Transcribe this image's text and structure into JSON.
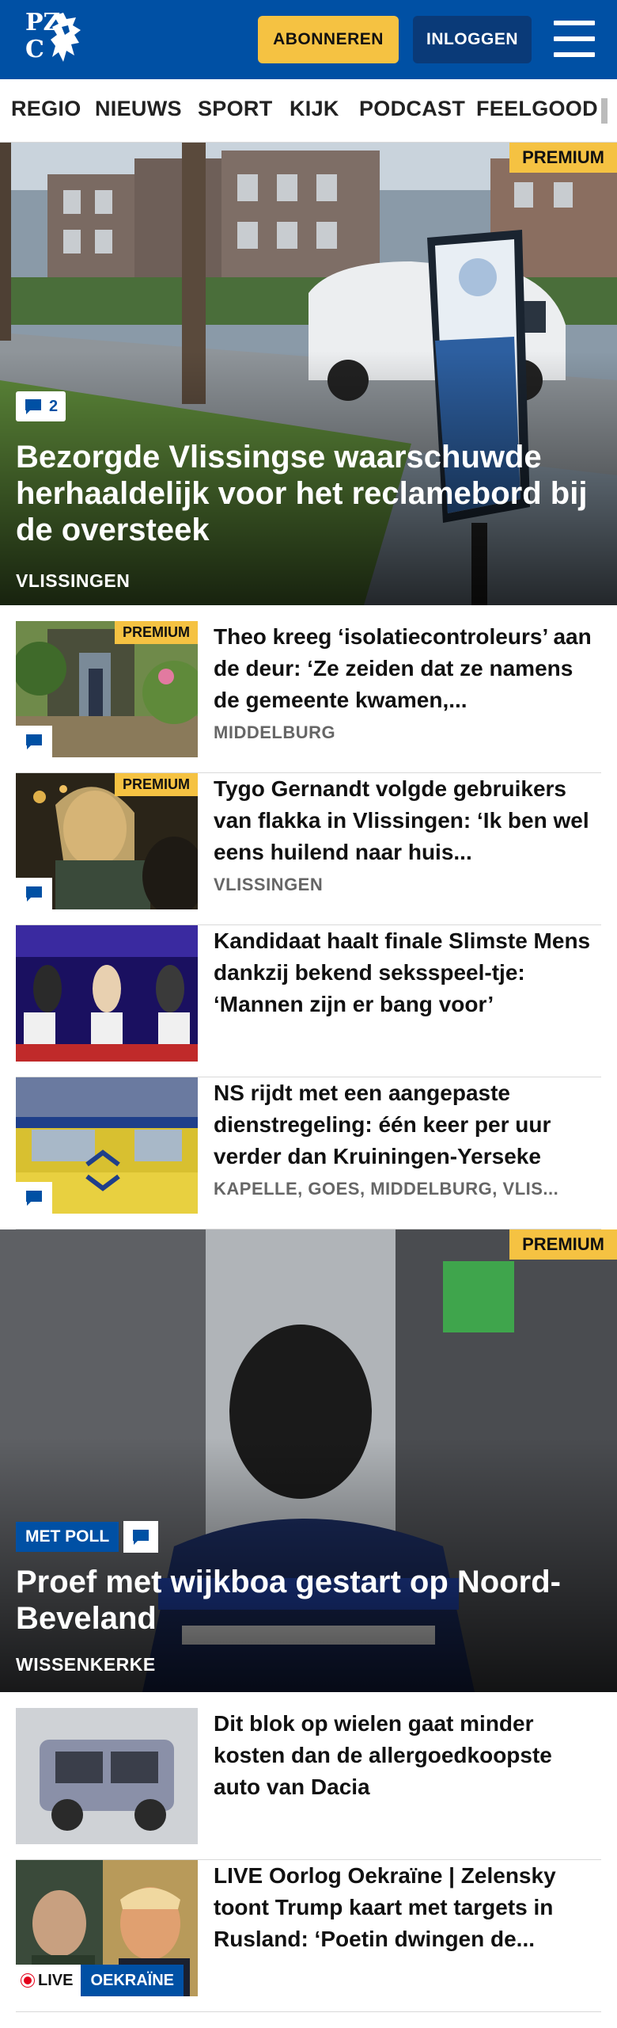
{
  "header": {
    "logo_line1": "PZ",
    "logo_line2": "C",
    "subscribe_label": "ABONNEREN",
    "login_label": "INLOGGEN",
    "menu_icon": "hamburger-menu-icon",
    "brand_color": "#0050a4",
    "accent_color": "#f5c242"
  },
  "nav": {
    "items": [
      "REGIO",
      "NIEUWS",
      "SPORT",
      "KIJK",
      "PODCAST",
      "FEELGOOD"
    ]
  },
  "hero1": {
    "premium": "PREMIUM",
    "comment_count": "2",
    "title": "Bezorgde Vlissingse waarschuwde herhaaldelijk voor het reclamebord bij de oversteek",
    "location": "VLISSINGEN"
  },
  "articles": [
    {
      "premium": "PREMIUM",
      "title": "Theo kreeg ‘isolatiecontroleurs’ aan de deur: ‘Ze zeiden dat ze namens de gemeente kwamen,...",
      "location": "MIDDELBURG"
    },
    {
      "premium": "PREMIUM",
      "title": "Tygo Gernandt volgde gebruikers van flakka in Vlissingen: ‘Ik ben wel eens huilend naar huis...",
      "location": "VLISSINGEN"
    },
    {
      "title": "Kandidaat haalt finale Slimste Mens dankzij bekend seksspeel-tje: ‘Mannen zijn er bang voor’"
    },
    {
      "title": "NS rijdt met een aangepaste dienstregeling: één keer per uur verder dan Kruiningen-Yerseke",
      "location": "KAPELLE, GOES, MIDDELBURG, VLIS..."
    }
  ],
  "hero2": {
    "premium": "PREMIUM",
    "poll_label": "MET POLL",
    "title": "Proef met wijkboa gestart op Noord-Beveland",
    "location": "WISSENKERKE"
  },
  "articles2": [
    {
      "title": "Dit blok op wielen gaat minder kosten dan de allergoedkoopste auto van Dacia"
    },
    {
      "title": "LIVE Oorlog Oekraïne | Zelensky toont Trump kaart met targets in Rusland: ‘Poetin dwingen de...",
      "live_label": "LIVE",
      "tag_label": "OEKRAÏNE"
    }
  ]
}
